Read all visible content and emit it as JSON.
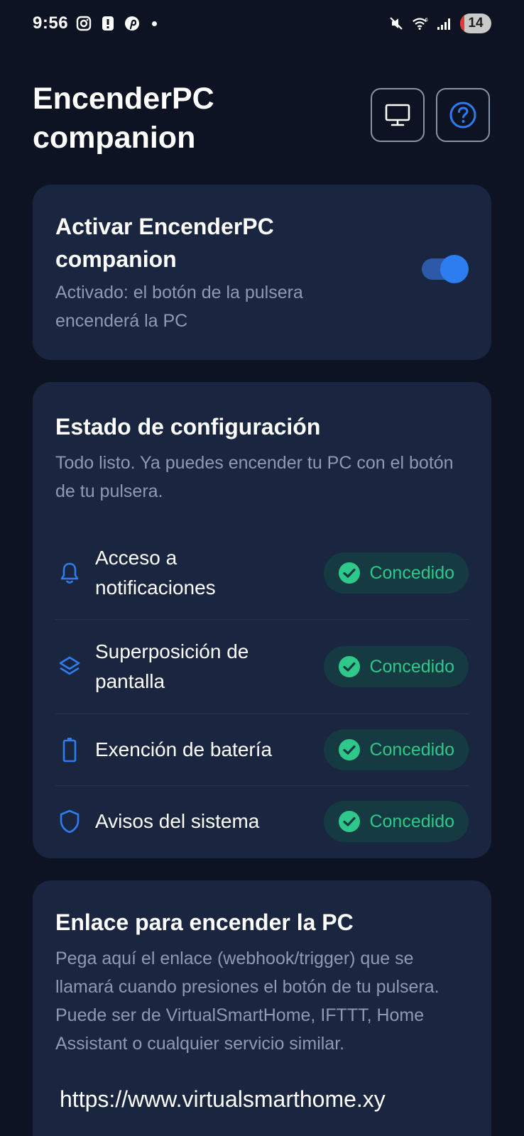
{
  "status_bar": {
    "time": "9:56",
    "battery_level": "14",
    "icons": [
      "instagram-icon",
      "alert-icon",
      "pinterest-icon",
      "dot-icon",
      "mute-icon",
      "wifi-icon",
      "signal-icon"
    ]
  },
  "header": {
    "title": "EncenderPC companion",
    "buttons": [
      "monitor-icon",
      "help-icon"
    ]
  },
  "activation": {
    "title": "Activar EncenderPC companion",
    "subtitle": "Activado: el botón de la pulsera encenderá la PC",
    "enabled": true
  },
  "config_status": {
    "title": "Estado de configuración",
    "subtitle": "Todo listo. Ya puedes encender tu PC con el botón de tu pulsera.",
    "permissions": [
      {
        "icon": "bell-icon",
        "label": "Acceso a notificaciones",
        "status": "Concedido"
      },
      {
        "icon": "layers-icon",
        "label": "Superposición de pantalla",
        "status": "Concedido"
      },
      {
        "icon": "battery-icon",
        "label": "Exención de batería",
        "status": "Concedido"
      },
      {
        "icon": "shield-icon",
        "label": "Avisos del sistema",
        "status": "Concedido"
      }
    ]
  },
  "link_section": {
    "title": "Enlace para encender la PC",
    "description": "Pega aquí el enlace (webhook/trigger) que se llamará cuando presiones el botón de tu pulsera. Puede ser de VirtualSmartHome, IFTTT, Home Assistant o cualquier servicio similar.",
    "value": "https://www.virtualsmarthome.xy"
  },
  "colors": {
    "background": "#0d1322",
    "card": "#1a2540",
    "accent": "#2e7df0",
    "success": "#2ec98a",
    "muted_text": "#8e9ab3"
  }
}
